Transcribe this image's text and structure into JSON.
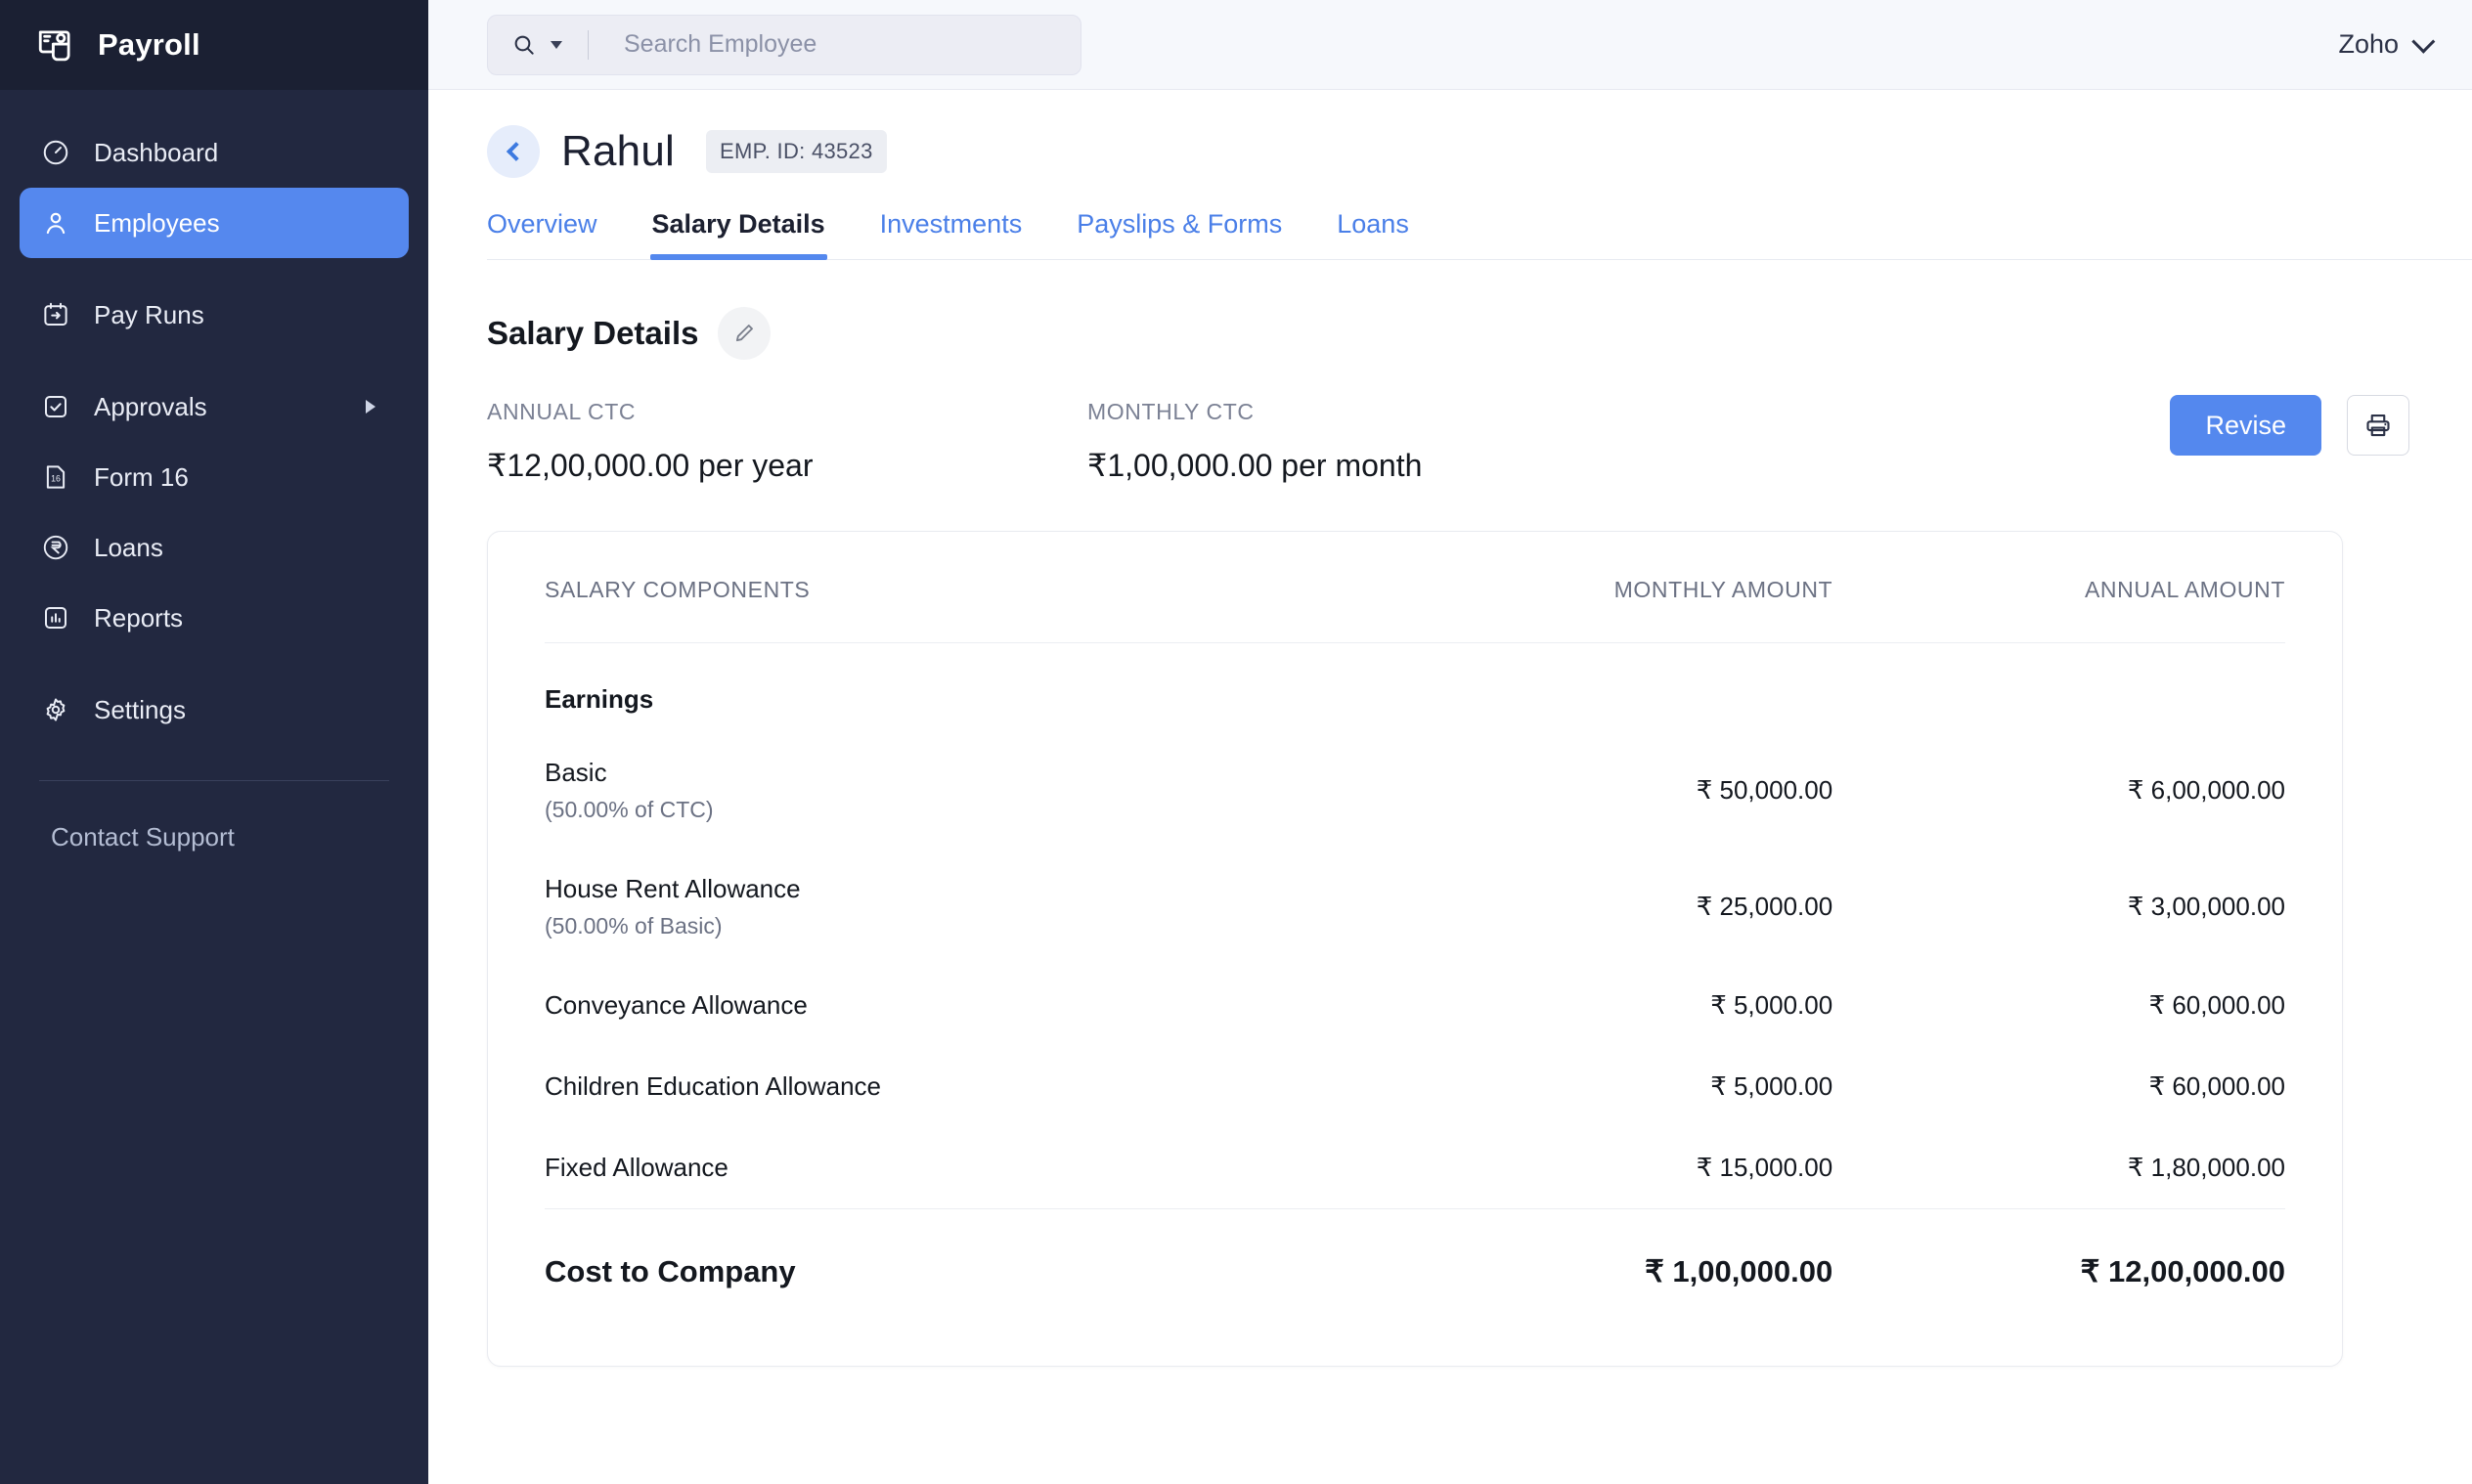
{
  "sidebar": {
    "brand": {
      "label": "Payroll",
      "icon": "payroll-logo-icon"
    },
    "items": [
      {
        "label": "Dashboard",
        "icon": "speedometer-icon",
        "active": false
      },
      {
        "label": "Employees",
        "icon": "user-icon",
        "active": true
      },
      {
        "label": "Pay Runs",
        "icon": "calendar-arrow-icon",
        "active": false
      },
      {
        "label": "Approvals",
        "icon": "checkbox-check-icon",
        "active": false,
        "caret": true
      },
      {
        "label": "Form 16",
        "icon": "document-16-icon",
        "active": false
      },
      {
        "label": "Loans",
        "icon": "rupee-circle-icon",
        "active": false
      },
      {
        "label": "Reports",
        "icon": "bar-chart-icon",
        "active": false
      },
      {
        "label": "Settings",
        "icon": "gear-icon",
        "active": false
      }
    ],
    "support_label": "Contact Support"
  },
  "topbar": {
    "search": {
      "placeholder": "Search Employee",
      "value": "",
      "icon": "search-icon"
    },
    "org": {
      "label": "Zoho",
      "icon": "chevron-down-icon"
    }
  },
  "page": {
    "back_icon": "chevron-left-icon",
    "employee_name": "Rahul",
    "employee_id_badge": "EMP. ID: 43523",
    "tabs": [
      {
        "label": "Overview",
        "active": false
      },
      {
        "label": "Salary Details",
        "active": true
      },
      {
        "label": "Investments",
        "active": false
      },
      {
        "label": "Payslips & Forms",
        "active": false
      },
      {
        "label": "Loans",
        "active": false
      }
    ]
  },
  "salary": {
    "section_title": "Salary Details",
    "edit_icon": "pencil-icon",
    "annual_ctc": {
      "label": "ANNUAL CTC",
      "value": "₹12,00,000.00 per year"
    },
    "monthly_ctc": {
      "label": "MONTHLY CTC",
      "value": "₹1,00,000.00 per month"
    },
    "revise_label": "Revise",
    "print_icon": "printer-icon",
    "table": {
      "headers": [
        "SALARY COMPONENTS",
        "MONTHLY AMOUNT",
        "ANNUAL AMOUNT"
      ],
      "section_label": "Earnings",
      "rows": [
        {
          "name": "Basic",
          "sub": "(50.00% of CTC)",
          "monthly": "₹ 50,000.00",
          "annual": "₹ 6,00,000.00"
        },
        {
          "name": "House Rent Allowance",
          "sub": "(50.00% of Basic)",
          "monthly": "₹ 25,000.00",
          "annual": "₹ 3,00,000.00"
        },
        {
          "name": "Conveyance Allowance",
          "sub": "",
          "monthly": "₹ 5,000.00",
          "annual": "₹ 60,000.00"
        },
        {
          "name": "Children Education Allowance",
          "sub": "",
          "monthly": "₹ 5,000.00",
          "annual": "₹ 60,000.00"
        },
        {
          "name": "Fixed Allowance",
          "sub": "",
          "monthly": "₹ 15,000.00",
          "annual": "₹ 1,80,000.00"
        }
      ],
      "total": {
        "name": "Cost to Company",
        "monthly": "₹ 1,00,000.00",
        "annual": "₹ 12,00,000.00"
      }
    }
  },
  "colors": {
    "sidebar_bg": "#222840",
    "sidebar_brand_bg": "#1b2033",
    "accent": "#5488ee",
    "tab_link": "#4a7fe8",
    "topbar_bg": "#f6f8fc",
    "badge_bg": "#eceef3"
  }
}
